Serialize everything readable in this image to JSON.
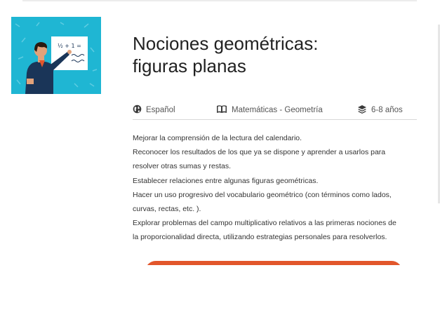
{
  "course": {
    "title_line1": "Nociones geométricas:",
    "title_line2": "figuras planas",
    "thumbnail": {
      "icon": "teacher-illustration",
      "board_formula": "½ + 1 =",
      "background_color": "#1fb6d3"
    }
  },
  "meta": {
    "language": {
      "icon": "globe-icon",
      "label": "Español"
    },
    "subject": {
      "icon": "book-icon",
      "label": "Matemáticas - Geometría"
    },
    "age": {
      "icon": "layers-icon",
      "label": "6-8 años"
    }
  },
  "objectives": [
    "Mejorar la comprensión de la lectura del calendario.",
    "Reconocer los resultados de los que ya se dispone y aprender a usarlos para",
    "resolver otras sumas y restas.",
    "Establecer relaciones entre algunas figuras geométricas.",
    "Hacer un uso progresivo del vocabulario geométrico (con términos como lados,",
    "curvas, rectas, etc. ).",
    "Explorar problemas del campo multiplicativo relativos a las primeras nociones de",
    "la proporcionalidad directa, utilizando estrategias personales para resolverlos."
  ],
  "colors": {
    "accent": "#e2562b",
    "thumbnail_bg": "#1fb6d3",
    "title": "#222222",
    "text": "#333333"
  }
}
